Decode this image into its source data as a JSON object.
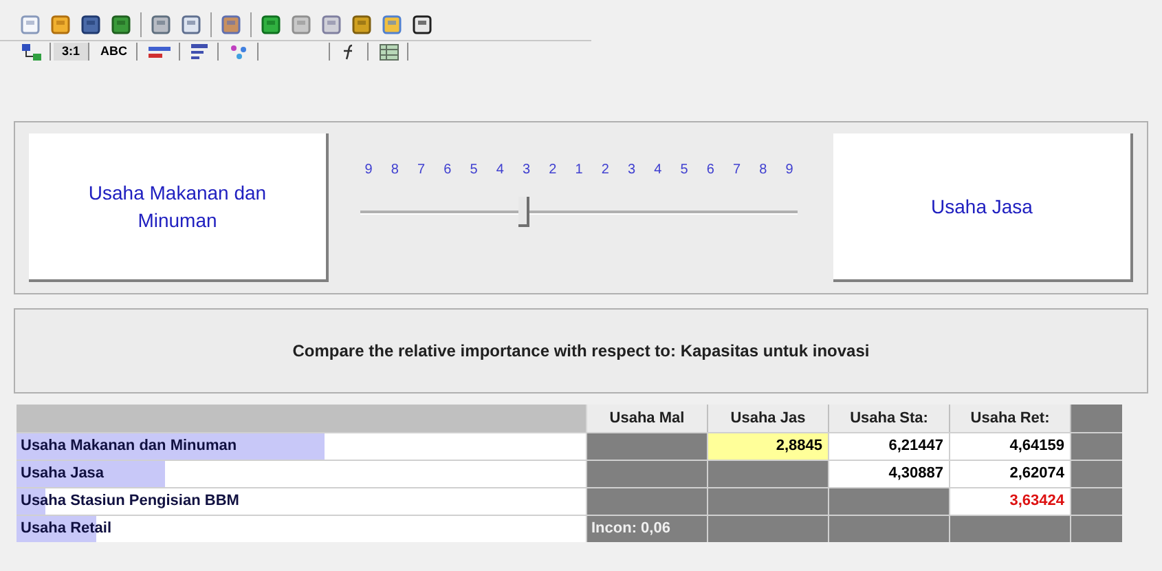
{
  "tabs": [
    {
      "kind": "icon",
      "selected": false
    },
    {
      "kind": "text",
      "label": "3:1",
      "selected": true
    },
    {
      "kind": "text",
      "label": "ABC",
      "selected": false
    },
    {
      "kind": "icon",
      "selected": false
    },
    {
      "kind": "icon",
      "selected": false
    },
    {
      "kind": "icon",
      "selected": false
    },
    {
      "kind": "blank",
      "selected": false
    },
    {
      "kind": "icon",
      "selected": false
    },
    {
      "kind": "icon",
      "selected": false
    }
  ],
  "comparison": {
    "left": "Usaha Makanan dan Minuman",
    "right": "Usaha Jasa",
    "scale": [
      "9",
      "8",
      "7",
      "6",
      "5",
      "4",
      "3",
      "2",
      "1",
      "2",
      "3",
      "4",
      "5",
      "6",
      "7",
      "8",
      "9"
    ],
    "level": 0.375
  },
  "prompt": "Compare the relative importance with respect to: Kapasitas untuk inovasi",
  "table": {
    "columns": [
      "Usaha Mal",
      "Usaha Jas",
      "Usaha Sta:",
      "Usaha Ret:"
    ],
    "rows": [
      {
        "label": "Usaha Makanan dan Minuman",
        "level": 0.54,
        "cells": [
          {
            "kind": "empty"
          },
          {
            "kind": "value",
            "text": "2,8845",
            "selected": true,
            "color": "#000000"
          },
          {
            "kind": "value",
            "text": "6,21447",
            "selected": false,
            "color": "#000000"
          },
          {
            "kind": "value",
            "text": "4,64159",
            "selected": false,
            "color": "#000000"
          }
        ]
      },
      {
        "label": "Usaha Jasa",
        "level": 0.26,
        "cells": [
          {
            "kind": "empty"
          },
          {
            "kind": "empty"
          },
          {
            "kind": "value",
            "text": "4,30887",
            "selected": false,
            "color": "#000000"
          },
          {
            "kind": "value",
            "text": "2,62074",
            "selected": false,
            "color": "#000000"
          }
        ]
      },
      {
        "label": "Usaha Stasiun Pengisian BBM",
        "level": 0.05,
        "cells": [
          {
            "kind": "empty"
          },
          {
            "kind": "empty"
          },
          {
            "kind": "empty"
          },
          {
            "kind": "value",
            "text": "3,63424",
            "selected": false,
            "color": "#dd1111"
          }
        ]
      },
      {
        "label": "Usaha Retail",
        "level": 0.14,
        "cells": [
          {
            "kind": "note",
            "text": "Incon: 0,06"
          },
          {
            "kind": "empty"
          },
          {
            "kind": "empty"
          },
          {
            "kind": "empty"
          }
        ]
      }
    ]
  }
}
